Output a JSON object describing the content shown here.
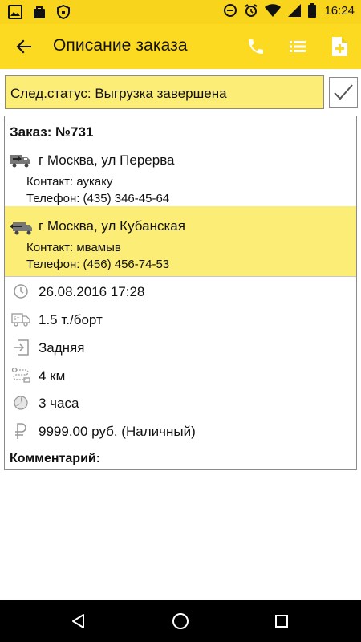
{
  "status_bar": {
    "time": "16:24",
    "left_icons": [
      "image-icon",
      "bag-icon",
      "shield-icon"
    ],
    "right_icons": [
      "minus-circle-icon",
      "alarm-icon",
      "wifi-icon",
      "signal-icon",
      "battery-icon"
    ]
  },
  "app_bar": {
    "title": "Описание заказа",
    "icons": [
      "arrow-back-icon",
      "phone-icon",
      "list-icon",
      "add-document-icon"
    ],
    "background": "#fcda22"
  },
  "next_status": {
    "text": "След.статус: Выгрузка завершена",
    "checked": true,
    "highlight": "#fbed75"
  },
  "order": {
    "title": "Заказ: №731",
    "from": {
      "address": "г Москва, ул Перерва",
      "contact": "Контакт: аукаку",
      "phone": "Телефон: (435) 346-45-64"
    },
    "to": {
      "address": "г Москва, ул Кубанская",
      "contact": "Контакт: мвамыв",
      "phone": "Телефон: (456) 456-74-53"
    },
    "details": [
      {
        "icon": "clock-icon",
        "text": "26.08.2016 17:28"
      },
      {
        "icon": "truck-weight-icon",
        "text": "1.5 т./борт"
      },
      {
        "icon": "loading-side-icon",
        "text": "Задняя"
      },
      {
        "icon": "route-icon",
        "text": "4 км"
      },
      {
        "icon": "pie-clock-icon",
        "text": "3 часа"
      },
      {
        "icon": "ruble-icon",
        "text": "9999.00 руб. (Наличный)"
      }
    ],
    "comment_label": "Комментарий:"
  },
  "nav_bar": {
    "icons": [
      "back-triangle-icon",
      "home-circle-icon",
      "recents-square-icon"
    ]
  }
}
